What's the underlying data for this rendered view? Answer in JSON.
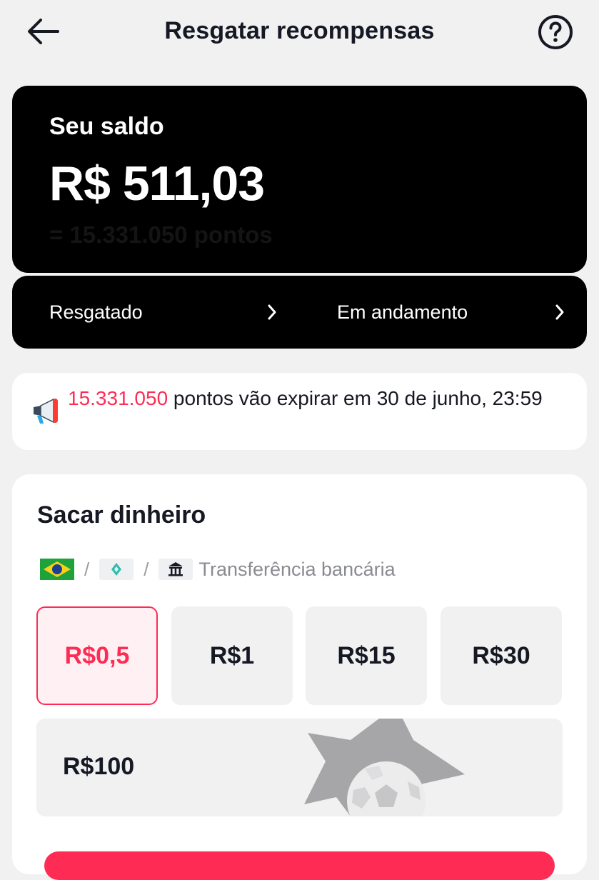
{
  "header": {
    "title": "Resgatar recompensas"
  },
  "balance": {
    "label": "Seu saldo",
    "value": "R$ 511,03",
    "points": "= 15.331.050 pontos"
  },
  "links": {
    "redeemed": "Resgatado",
    "in_progress": "Em andamento"
  },
  "notice": {
    "points": "15.331.050",
    "message": " pontos vão expirar em 30 de junho, 23:59"
  },
  "withdraw": {
    "title": "Sacar dinheiro",
    "separator": "/",
    "methods": [
      {
        "icon": "brazil-flag-icon"
      },
      {
        "icon": "pix-icon"
      },
      {
        "icon": "bank-icon",
        "label": "Transferência bancária"
      }
    ],
    "amounts": [
      "R$0,5",
      "R$1",
      "R$15",
      "R$30",
      "R$100"
    ],
    "selected_amount": "R$0,5"
  },
  "colors": {
    "accent": "#fe2c55",
    "card_dark": "#000000",
    "background": "#f1f1f2"
  }
}
